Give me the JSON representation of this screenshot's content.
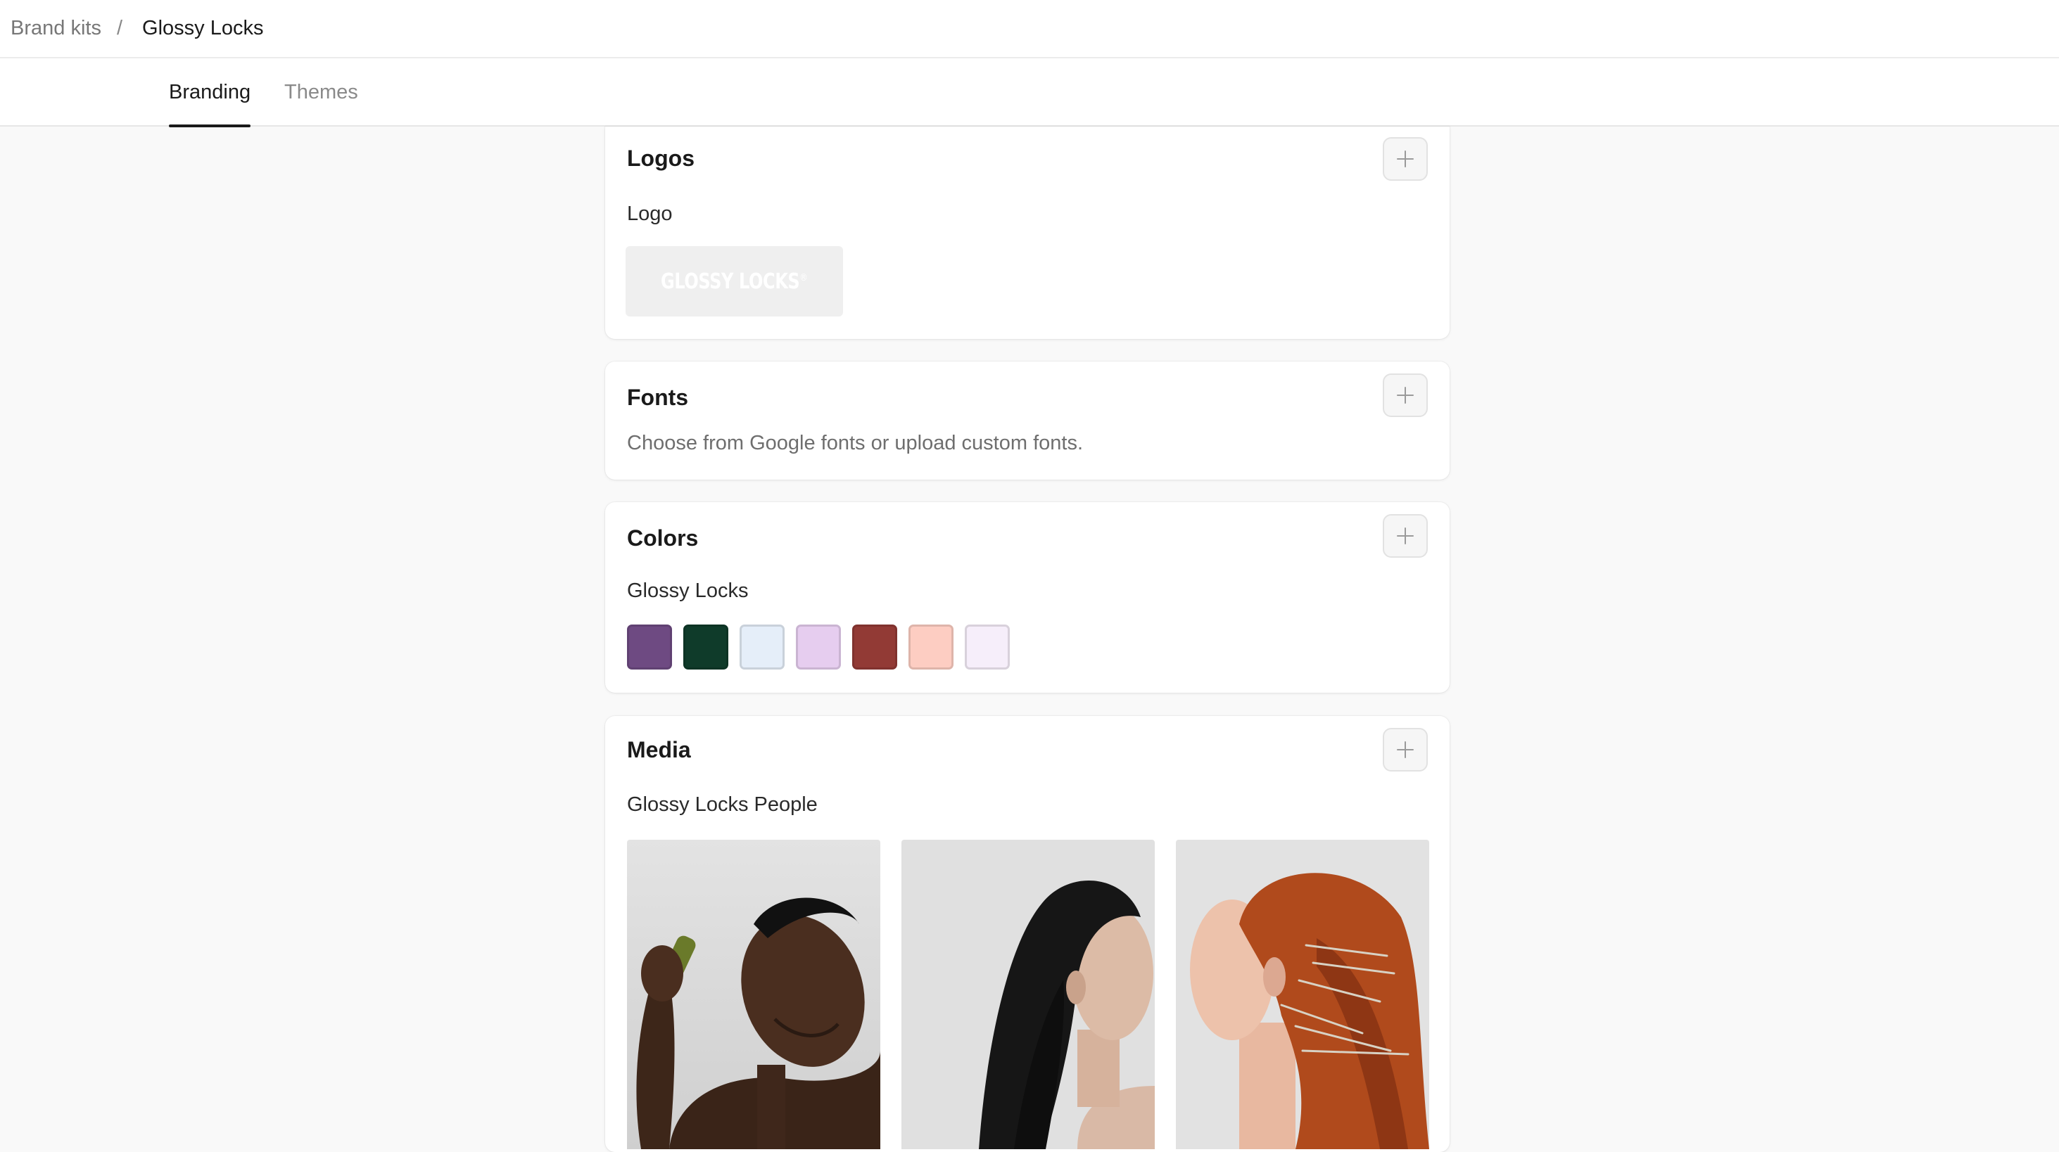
{
  "breadcrumb": {
    "parent": "Brand kits",
    "separator": "/",
    "current": "Glossy Locks"
  },
  "tabs": [
    {
      "label": "Branding",
      "active": true
    },
    {
      "label": "Themes",
      "active": false
    }
  ],
  "logos": {
    "title": "Logos",
    "add_icon": "plus-icon",
    "item_label": "Logo",
    "logo_text": "GLOSSY LOCKS",
    "logo_mark": "®"
  },
  "fonts": {
    "title": "Fonts",
    "add_icon": "plus-icon",
    "description": "Choose from Google fonts or upload custom fonts."
  },
  "colors": {
    "title": "Colors",
    "add_icon": "plus-icon",
    "palette_name": "Glossy Locks",
    "swatches": [
      "#6e4a82",
      "#0f3b2a",
      "#e5eef9",
      "#e6cdef",
      "#923a35",
      "#fdcdc2",
      "#f6eefa"
    ]
  },
  "media": {
    "title": "Media",
    "add_icon": "plus-icon",
    "collection_name": "Glossy Locks People",
    "images": [
      {
        "subject": "man-with-spray-bottle"
      },
      {
        "subject": "woman-with-dark-hair-profile"
      },
      {
        "subject": "woman-with-red-hair-and-pins"
      }
    ]
  }
}
